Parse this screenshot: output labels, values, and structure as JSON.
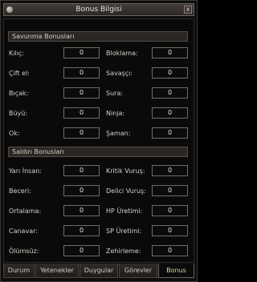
{
  "window": {
    "title": "Bonus Bilgisi",
    "close_label": "x"
  },
  "defense": {
    "header": "Savunma Bonusları",
    "rows": [
      {
        "left_label": "Kılıç:",
        "left_value": "0",
        "right_label": "Bloklama:",
        "right_value": "0"
      },
      {
        "left_label": "Çift el:",
        "left_value": "0",
        "right_label": "Savaşçı:",
        "right_value": "0"
      },
      {
        "left_label": "Bıçak:",
        "left_value": "0",
        "right_label": "Sura:",
        "right_value": "0"
      },
      {
        "left_label": "Büyü:",
        "left_value": "0",
        "right_label": "Ninja:",
        "right_value": "0"
      },
      {
        "left_label": "Ok:",
        "left_value": "0",
        "right_label": "Şaman:",
        "right_value": "0"
      }
    ]
  },
  "attack": {
    "header": "Saldırı Bonusları",
    "rows": [
      {
        "left_label": "Yarı İnsan:",
        "left_value": "0",
        "right_label": "Kritik Vuruş:",
        "right_value": "0"
      },
      {
        "left_label": "Beceri:",
        "left_value": "0",
        "right_label": "Delici Vuruş:",
        "right_value": "0"
      },
      {
        "left_label": "Ortalama:",
        "left_value": "0",
        "right_label": "HP Üretimi:",
        "right_value": "0"
      },
      {
        "left_label": "Canavar:",
        "left_value": "0",
        "right_label": "SP Üretimi:",
        "right_value": "0"
      },
      {
        "left_label": "Ölümsüz:",
        "left_value": "0",
        "right_label": "Zehirleme:",
        "right_value": "0"
      }
    ]
  },
  "tabs": [
    "Durum",
    "Yetenekler",
    "Duygular",
    "Görevler",
    "Bonus"
  ],
  "active_tab": "Bonus"
}
